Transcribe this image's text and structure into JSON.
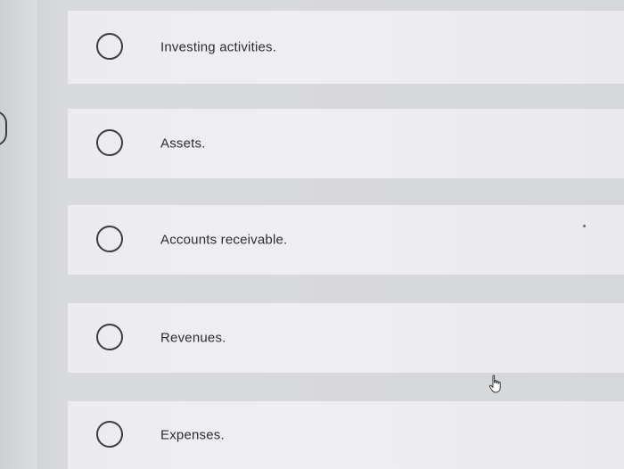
{
  "question": {
    "options": [
      {
        "label": "Investing activities.",
        "selected": false
      },
      {
        "label": "Assets.",
        "selected": false
      },
      {
        "label": "Accounts receivable.",
        "selected": false
      },
      {
        "label": "Revenues.",
        "selected": false
      },
      {
        "label": "Expenses.",
        "selected": false
      }
    ]
  },
  "icons": {
    "radio": "radio-unchecked-icon",
    "cursor": "pointer-hand-icon"
  },
  "colors": {
    "option_background": "#ececee",
    "radio_border": "#3b3d42",
    "text": "#2b2d31"
  }
}
